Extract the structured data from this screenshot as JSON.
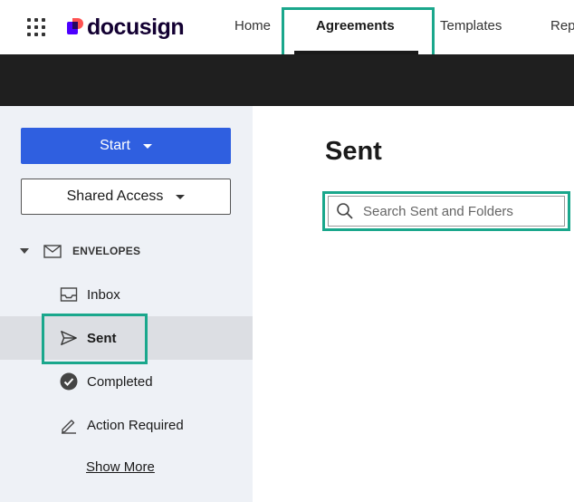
{
  "header": {
    "logo_text": "docusign",
    "nav": [
      {
        "label": "Home"
      },
      {
        "label": "Agreements",
        "active": true
      },
      {
        "label": "Templates"
      },
      {
        "label": "Rep"
      }
    ]
  },
  "sidebar": {
    "start_label": "Start",
    "shared_access_label": "Shared Access",
    "section_label": "ENVELOPES",
    "items": [
      {
        "label": "Inbox",
        "icon": "inbox-icon"
      },
      {
        "label": "Sent",
        "icon": "send-icon",
        "selected": true
      },
      {
        "label": "Completed",
        "icon": "check-circle-icon"
      },
      {
        "label": "Action Required",
        "icon": "pencil-icon"
      }
    ],
    "show_more_label": "Show More"
  },
  "main": {
    "title": "Sent",
    "search_placeholder": "Search Sent and Folders"
  },
  "colors": {
    "accent": "#2f5fe0",
    "highlight": "#1aa78c",
    "sidebar_bg": "#eef1f6",
    "dark_band": "#1f1f1f"
  }
}
